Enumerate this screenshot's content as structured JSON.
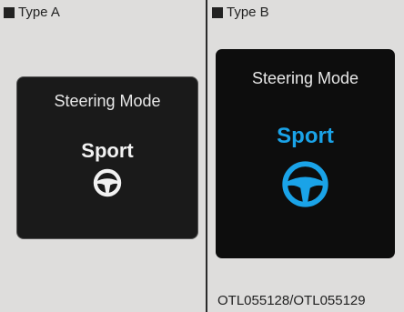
{
  "panel_a": {
    "type_label": "Type A",
    "screen_title": "Steering Mode",
    "mode_value": "Sport",
    "text_color": "#f2f2f2"
  },
  "panel_b": {
    "type_label": "Type B",
    "screen_title": "Steering Mode",
    "mode_value": "Sport",
    "accent_color": "#1aa3e8"
  },
  "caption": "OTL055128/OTL055129",
  "icons": {
    "square_marker": "filled-square",
    "steering_wheel": "steering-wheel-icon"
  }
}
